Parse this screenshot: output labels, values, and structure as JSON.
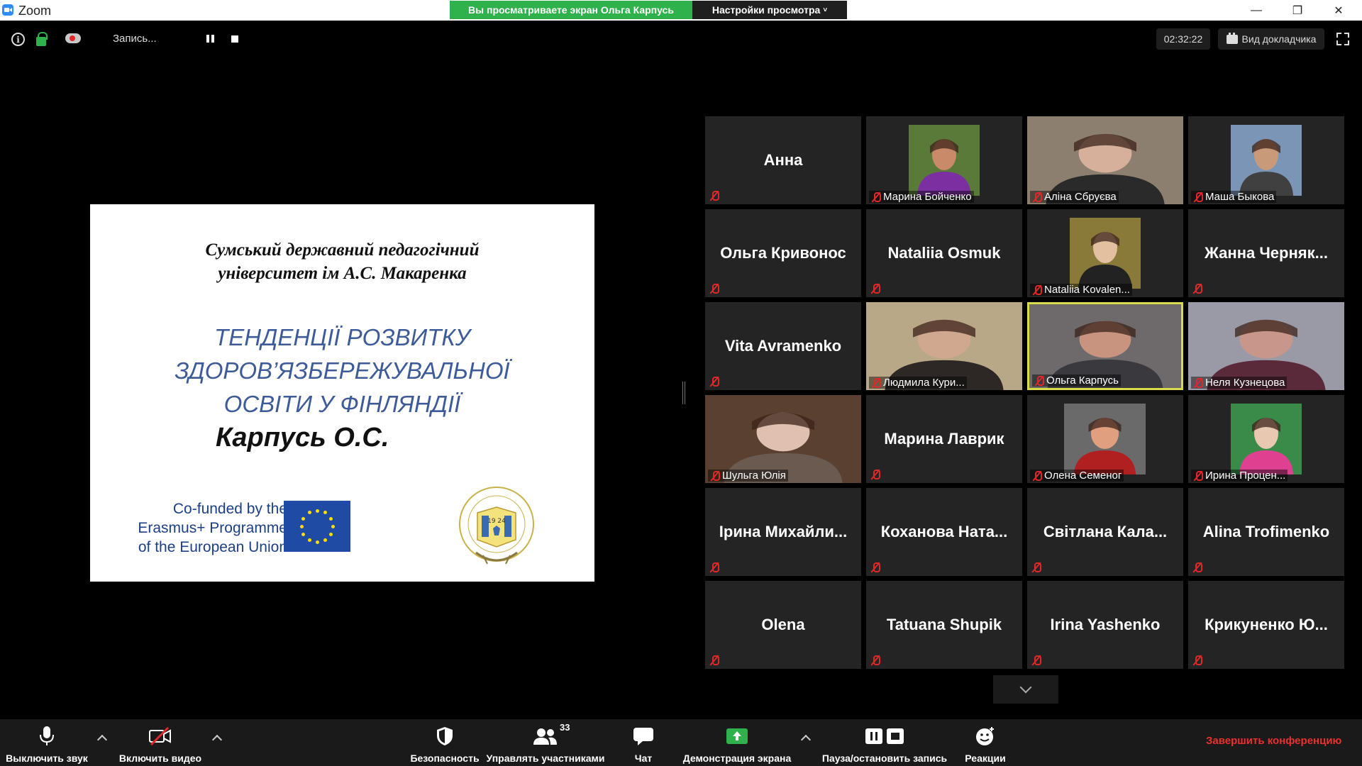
{
  "window": {
    "app_name": "Zoom",
    "viewing_banner": "Вы просматриваете экран Ольга Карпусь",
    "view_options": "Настройки просмотра",
    "minimize": "—",
    "maximize": "❐",
    "close": "✕"
  },
  "top_toolbar": {
    "recording_label": "Запись...",
    "timer": "02:32:22",
    "speaker_view": "Вид докладчика"
  },
  "slide": {
    "university_line1": "Сумський державний педагогічний",
    "university_line2": "університет ім А.С. Макаренка",
    "title_line1": "ТЕНДЕНЦІЇ РОЗВИТКУ",
    "title_line2": "ЗДОРОВ’ЯЗБЕРЕЖУВАЛЬНОЇ",
    "title_line3": "ОСВІТИ У ФІНЛЯНДІЇ",
    "author": "Карпусь О.С.",
    "cofund_line1": "Co-funded by the",
    "cofund_line2": "Erasmus+ Programme",
    "cofund_line3": "of the European Union",
    "seal_year": "19 24"
  },
  "participants": [
    {
      "name": "Анна",
      "video": false
    },
    {
      "name": "Марина Бойченко",
      "video": true,
      "bg": "#5a7a3a",
      "skin": "#c98a6a",
      "shirt": "#7c2fa0"
    },
    {
      "name": "Аліна Сбруєва",
      "video": true,
      "bg": "#8c7f70",
      "skin": "#d6b09a",
      "shirt": "#2a2a2a"
    },
    {
      "name": "Маша Быкова",
      "video": true,
      "bg": "#7a95b5",
      "skin": "#c99a7a",
      "shirt": "#404040"
    },
    {
      "name": "Ольга Кривонос",
      "video": false
    },
    {
      "name": "Nataliia Osmuk",
      "video": false
    },
    {
      "name": "Nataliia Kovalen...",
      "video": true,
      "bg": "#8a7a3a",
      "skin": "#e2c0a0",
      "shirt": "#222222"
    },
    {
      "name": "Жанна Черняк...",
      "video": false
    },
    {
      "name": "Vita Avramenko",
      "video": false
    },
    {
      "name": "Людмила Кури...",
      "video": true,
      "bg": "#b9a888",
      "skin": "#d0a890",
      "shirt": "#2d2826"
    },
    {
      "name": "Ольга Карпусь",
      "video": true,
      "active": true,
      "bg": "#6e6a6c",
      "skin": "#c89480",
      "shirt": "#3a3a3e"
    },
    {
      "name": "Неля Кузнецова",
      "video": true,
      "bg": "#9a9aa6",
      "skin": "#c8968a",
      "shirt": "#5a2a3a"
    },
    {
      "name": "Шульга Юлія",
      "video": true,
      "bg": "#5a4030",
      "skin": "#e0c0b0",
      "shirt": "#6a5a50"
    },
    {
      "name": "Марина Лаврик",
      "video": false
    },
    {
      "name": "Олена Семеног",
      "video": true,
      "bg": "#6a6a6a",
      "skin": "#e0a080",
      "shirt": "#b02020"
    },
    {
      "name": "Ирина Процен...",
      "video": true,
      "bg": "#3a8a4a",
      "skin": "#e8c8b0",
      "shirt": "#e04090"
    },
    {
      "name": "Ірина  Михайли...",
      "video": false
    },
    {
      "name": "Коханова  Ната...",
      "video": false
    },
    {
      "name": "Світлана  Кала...",
      "video": false
    },
    {
      "name": "Alina Trofimenko",
      "video": false
    },
    {
      "name": "Olena",
      "video": false
    },
    {
      "name": "Tatuana Shupik",
      "video": false
    },
    {
      "name": "Irina Yashenko",
      "video": false
    },
    {
      "name": "Крикуненко  Ю...",
      "video": false
    }
  ],
  "bottom_toolbar": {
    "mute": "Выключить звук",
    "video": "Включить видео",
    "security": "Безопасность",
    "participants": "Управлять участниками",
    "participants_count": "33",
    "chat": "Чат",
    "share": "Демонстрация экрана",
    "record": "Пауза/остановить запись",
    "reactions": "Реакции",
    "end": "Завершить конференцию"
  },
  "colors": {
    "banner_green": "#2fb24c",
    "active_speaker": "#d9dc4a",
    "end_red": "#e8322e",
    "slide_title_blue": "#3d5a99"
  }
}
